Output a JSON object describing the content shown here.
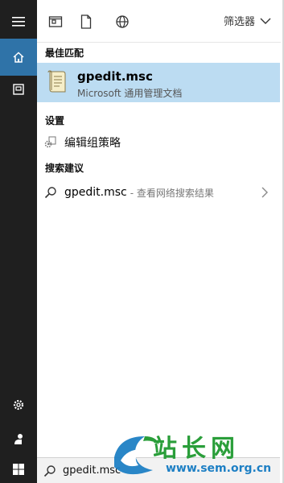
{
  "toolbar": {
    "filter_label": "筛选器"
  },
  "sections": {
    "best_match": "最佳匹配",
    "settings": "设置",
    "suggestions": "搜索建议"
  },
  "best_match_item": {
    "title": "gpedit.msc",
    "subtitle": "Microsoft 通用管理文档"
  },
  "settings_item": {
    "label": "编辑组策略"
  },
  "suggestion_item": {
    "query": "gpedit.msc",
    "hint": "- 查看网络搜索结果"
  },
  "search": {
    "value": "gpedit.msc"
  },
  "watermark": {
    "brand": "站长网",
    "url": "www.sem.org.cn"
  },
  "colors": {
    "rail": "#1f1f1f",
    "rail_active": "#2f73a8",
    "selection": "#bcdcf2",
    "watermark_green": "#2a9e3a",
    "watermark_blue": "#1d7fc4"
  },
  "icons": [
    "hamburger-icon",
    "home-icon",
    "document-square-icon",
    "settings-gear-icon",
    "user-icon",
    "windows-start-icon",
    "tablet-mode-icon",
    "document-icon",
    "globe-icon",
    "chevron-down-icon",
    "msc-document-icon",
    "group-policy-icon",
    "search-icon",
    "chevron-right-icon"
  ]
}
